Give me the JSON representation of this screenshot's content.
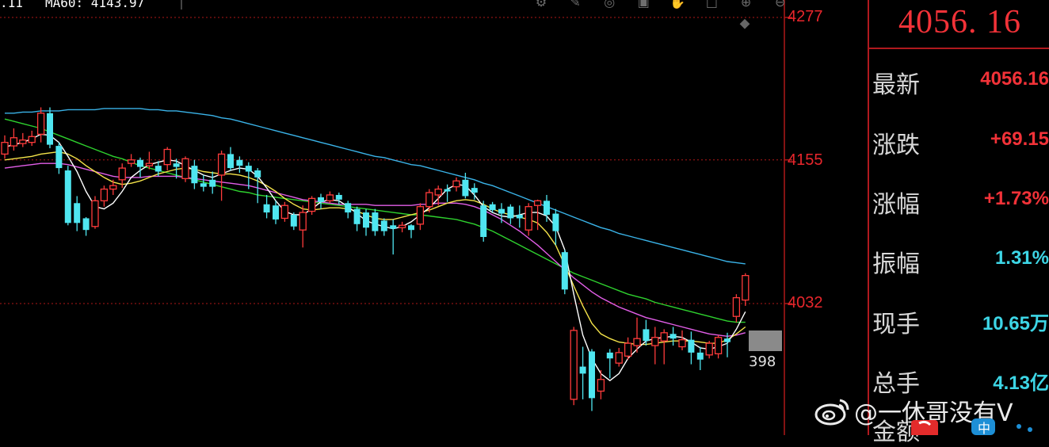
{
  "header": {
    "ma_fragment": ".11",
    "ma60_text": "MA60: 4143.97"
  },
  "toolbar": {
    "icons": [
      "gear-icon",
      "brush-icon",
      "target-icon",
      "image-icon",
      "hand-icon",
      "square-icon",
      "zoom-in-icon",
      "zoom-out-icon"
    ]
  },
  "axis": {
    "top_label": "4277",
    "mid_label": "4155",
    "low_label": "4032"
  },
  "volume_tag": "398",
  "quote": {
    "last_price": "4056. 16",
    "rows": [
      {
        "label": "最新",
        "value": "4056.16",
        "color": "#f23238"
      },
      {
        "label": "涨跌",
        "value": "+69.15",
        "color": "#f23238"
      },
      {
        "label": "涨幅",
        "value": "+1.73%",
        "color": "#f23238"
      },
      {
        "label": "振幅",
        "value": "1.31%",
        "color": "#3dd6e6"
      },
      {
        "label": "现手",
        "value": "10.65万",
        "color": "#3dd6e6"
      },
      {
        "label": "总手",
        "value": "4.13亿",
        "color": "#3dd6e6"
      },
      {
        "label": "金额",
        "value": "",
        "color": "#3dd6e6"
      }
    ]
  },
  "watermark": {
    "text": "@一休哥没有V"
  },
  "colors": {
    "up": "#ff3b3b",
    "down": "#4fe6f0",
    "ma5": "#ffffff",
    "ma10": "#f5e44a",
    "ma20": "#e25ee8",
    "ma30": "#2ed12e",
    "ma60": "#3ab3e8",
    "grid": "#b01818"
  },
  "chart_data": {
    "type": "candlestick",
    "y_ticks": [
      4277,
      4155,
      4032
    ],
    "candles": [
      {
        "o": 4160,
        "c": 4170,
        "h": 4176,
        "l": 4156,
        "up": true
      },
      {
        "o": 4167,
        "c": 4174,
        "h": 4182,
        "l": 4163,
        "up": true
      },
      {
        "o": 4169,
        "c": 4172,
        "h": 4178,
        "l": 4166,
        "up": true
      },
      {
        "o": 4170,
        "c": 4175,
        "h": 4180,
        "l": 4167,
        "up": true
      },
      {
        "o": 4177,
        "c": 4195,
        "h": 4200,
        "l": 4170,
        "up": true
      },
      {
        "o": 4195,
        "c": 4168,
        "h": 4200,
        "l": 4165,
        "up": false
      },
      {
        "o": 4167,
        "c": 4148,
        "h": 4170,
        "l": 4143,
        "up": false
      },
      {
        "o": 4146,
        "c": 4101,
        "h": 4150,
        "l": 4099,
        "up": false
      },
      {
        "o": 4118,
        "c": 4101,
        "h": 4124,
        "l": 4094,
        "up": false
      },
      {
        "o": 4105,
        "c": 4095,
        "h": 4106,
        "l": 4090,
        "up": false
      },
      {
        "o": 4098,
        "c": 4120,
        "h": 4124,
        "l": 4096,
        "up": true
      },
      {
        "o": 4120,
        "c": 4130,
        "h": 4133,
        "l": 4115,
        "up": true
      },
      {
        "o": 4130,
        "c": 4133,
        "h": 4138,
        "l": 4125,
        "up": true
      },
      {
        "o": 4138,
        "c": 4148,
        "h": 4152,
        "l": 4131,
        "up": true
      },
      {
        "o": 4152,
        "c": 4155,
        "h": 4160,
        "l": 4149,
        "up": true
      },
      {
        "o": 4155,
        "c": 4149,
        "h": 4157,
        "l": 4140,
        "up": false
      },
      {
        "o": 4150,
        "c": 4152,
        "h": 4162,
        "l": 4147,
        "up": true
      },
      {
        "o": 4150,
        "c": 4145,
        "h": 4154,
        "l": 4141,
        "up": false
      },
      {
        "o": 4151,
        "c": 4164,
        "h": 4166,
        "l": 4146,
        "up": true
      },
      {
        "o": 4152,
        "c": 4149,
        "h": 4156,
        "l": 4139,
        "up": false
      },
      {
        "o": 4139,
        "c": 4156,
        "h": 4158,
        "l": 4136,
        "up": true
      },
      {
        "o": 4150,
        "c": 4135,
        "h": 4155,
        "l": 4130,
        "up": false
      },
      {
        "o": 4135,
        "c": 4132,
        "h": 4142,
        "l": 4128,
        "up": false
      },
      {
        "o": 4138,
        "c": 4132,
        "h": 4145,
        "l": 4126,
        "up": false
      },
      {
        "o": 4142,
        "c": 4160,
        "h": 4163,
        "l": 4120,
        "up": true
      },
      {
        "o": 4160,
        "c": 4148,
        "h": 4166,
        "l": 4146,
        "up": false
      },
      {
        "o": 4155,
        "c": 4150,
        "h": 4158,
        "l": 4144,
        "up": false
      },
      {
        "o": 4150,
        "c": 4145,
        "h": 4153,
        "l": 4130,
        "up": false
      },
      {
        "o": 4146,
        "c": 4140,
        "h": 4148,
        "l": 4118,
        "up": false
      },
      {
        "o": 4117,
        "c": 4110,
        "h": 4125,
        "l": 4105,
        "up": false
      },
      {
        "o": 4116,
        "c": 4104,
        "h": 4120,
        "l": 4100,
        "up": false
      },
      {
        "o": 4105,
        "c": 4116,
        "h": 4119,
        "l": 4102,
        "up": true
      },
      {
        "o": 4108,
        "c": 4098,
        "h": 4110,
        "l": 4095,
        "up": false
      },
      {
        "o": 4095,
        "c": 4110,
        "h": 4116,
        "l": 4080,
        "up": true
      },
      {
        "o": 4111,
        "c": 4122,
        "h": 4124,
        "l": 4108,
        "up": true
      },
      {
        "o": 4123,
        "c": 4119,
        "h": 4126,
        "l": 4113,
        "up": false
      },
      {
        "o": 4120,
        "c": 4125,
        "h": 4128,
        "l": 4118,
        "up": true
      },
      {
        "o": 4125,
        "c": 4121,
        "h": 4127,
        "l": 4117,
        "up": false
      },
      {
        "o": 4118,
        "c": 4110,
        "h": 4120,
        "l": 4105,
        "up": false
      },
      {
        "o": 4113,
        "c": 4100,
        "h": 4115,
        "l": 4094,
        "up": false
      },
      {
        "o": 4110,
        "c": 4097,
        "h": 4113,
        "l": 4090,
        "up": false
      },
      {
        "o": 4110,
        "c": 4094,
        "h": 4113,
        "l": 4090,
        "up": false
      },
      {
        "o": 4103,
        "c": 4094,
        "h": 4105,
        "l": 4090,
        "up": false
      },
      {
        "o": 4099,
        "c": 4096,
        "h": 4104,
        "l": 4074,
        "up": false
      },
      {
        "o": 4097,
        "c": 4099,
        "h": 4102,
        "l": 4093,
        "up": true
      },
      {
        "o": 4099,
        "c": 4095,
        "h": 4100,
        "l": 4088,
        "up": false
      },
      {
        "o": 4100,
        "c": 4115,
        "h": 4118,
        "l": 4095,
        "up": true
      },
      {
        "o": 4115,
        "c": 4127,
        "h": 4130,
        "l": 4110,
        "up": true
      },
      {
        "o": 4125,
        "c": 4130,
        "h": 4133,
        "l": 4116,
        "up": true
      },
      {
        "o": 4130,
        "c": 4128,
        "h": 4134,
        "l": 4119,
        "up": false
      },
      {
        "o": 4132,
        "c": 4137,
        "h": 4140,
        "l": 4128,
        "up": true
      },
      {
        "o": 4138,
        "c": 4124,
        "h": 4144,
        "l": 4122,
        "up": false
      },
      {
        "o": 4131,
        "c": 4127,
        "h": 4135,
        "l": 4121,
        "up": false
      },
      {
        "o": 4116,
        "c": 4089,
        "h": 4120,
        "l": 4085,
        "up": false
      },
      {
        "o": 4117,
        "c": 4112,
        "h": 4119,
        "l": 4110,
        "up": false
      },
      {
        "o": 4113,
        "c": 4109,
        "h": 4118,
        "l": 4101,
        "up": false
      },
      {
        "o": 4115,
        "c": 4105,
        "h": 4117,
        "l": 4100,
        "up": false
      },
      {
        "o": 4108,
        "c": 4105,
        "h": 4116,
        "l": 4097,
        "up": false
      },
      {
        "o": 4095,
        "c": 4115,
        "h": 4118,
        "l": 4090,
        "up": true
      },
      {
        "o": 4116,
        "c": 4120,
        "h": 4121,
        "l": 4095,
        "up": true
      },
      {
        "o": 4120,
        "c": 4108,
        "h": 4125,
        "l": 4102,
        "up": false
      },
      {
        "o": 4109,
        "c": 4094,
        "h": 4113,
        "l": 4082,
        "up": false
      },
      {
        "o": 4076,
        "c": 4044,
        "h": 4078,
        "l": 4040,
        "up": false
      },
      {
        "o": 3950,
        "c": 4009,
        "h": 4012,
        "l": 3945,
        "up": true
      },
      {
        "o": 3978,
        "c": 3972,
        "h": 3995,
        "l": 3950,
        "up": false
      },
      {
        "o": 3991,
        "c": 3951,
        "h": 3993,
        "l": 3940,
        "up": false
      },
      {
        "o": 3957,
        "c": 3967,
        "h": 3975,
        "l": 3950,
        "up": true
      },
      {
        "o": 3990,
        "c": 3985,
        "h": 3993,
        "l": 3968,
        "up": false
      },
      {
        "o": 3981,
        "c": 3990,
        "h": 3994,
        "l": 3978,
        "up": true
      },
      {
        "o": 3987,
        "c": 3998,
        "h": 4003,
        "l": 3984,
        "up": true
      },
      {
        "o": 3996,
        "c": 4002,
        "h": 4020,
        "l": 3990,
        "up": true
      },
      {
        "o": 4010,
        "c": 4000,
        "h": 4018,
        "l": 3996,
        "up": false
      },
      {
        "o": 3996,
        "c": 4003,
        "h": 4012,
        "l": 3980,
        "up": true
      },
      {
        "o": 4000,
        "c": 4007,
        "h": 4010,
        "l": 3980,
        "up": true
      },
      {
        "o": 4006,
        "c": 4002,
        "h": 4012,
        "l": 3996,
        "up": false
      },
      {
        "o": 3995,
        "c": 4001,
        "h": 4009,
        "l": 3992,
        "up": true
      },
      {
        "o": 4001,
        "c": 3990,
        "h": 4008,
        "l": 3980,
        "up": false
      },
      {
        "o": 3990,
        "c": 3984,
        "h": 3995,
        "l": 3975,
        "up": false
      },
      {
        "o": 3988,
        "c": 3998,
        "h": 4000,
        "l": 3985,
        "up": true
      },
      {
        "o": 3989,
        "c": 4003,
        "h": 4005,
        "l": 3985,
        "up": true
      },
      {
        "o": 4002,
        "c": 3999,
        "h": 4007,
        "l": 3986,
        "up": false
      },
      {
        "o": 4021,
        "c": 4037,
        "h": 4040,
        "l": 4016,
        "up": true
      },
      {
        "o": 4035,
        "c": 4056,
        "h": 4058,
        "l": 4030,
        "up": true
      }
    ],
    "ma5": [
      4166,
      4168,
      4170,
      4173,
      4177,
      4176,
      4170,
      4158,
      4145,
      4128,
      4115,
      4113,
      4118,
      4128,
      4140,
      4146,
      4151,
      4153,
      4155,
      4154,
      4150,
      4146,
      4142,
      4140,
      4143,
      4146,
      4148,
      4147,
      4141,
      4131,
      4120,
      4111,
      4108,
      4108,
      4113,
      4119,
      4121,
      4120,
      4115,
      4109,
      4103,
      4100,
      4098,
      4096,
      4098,
      4102,
      4108,
      4114,
      4122,
      4130,
      4134,
      4133,
      4125,
      4115,
      4110,
      4107,
      4106,
      4108,
      4110,
      4110,
      4107,
      4098,
      4078,
      4040,
      4005,
      3985,
      3972,
      3966,
      3972,
      3985,
      3993,
      4000,
      4002,
      4003,
      4004,
      4003,
      3999,
      3994,
      3993,
      3995,
      3998,
      4010,
      4025
    ],
    "ma10": [
      4155,
      4156,
      4157,
      4158,
      4160,
      4161,
      4162,
      4160,
      4156,
      4150,
      4145,
      4140,
      4136,
      4134,
      4135,
      4137,
      4140,
      4143,
      4145,
      4147,
      4148,
      4147,
      4145,
      4144,
      4143,
      4143,
      4142,
      4140,
      4137,
      4133,
      4128,
      4122,
      4117,
      4113,
      4112,
      4113,
      4114,
      4114,
      4113,
      4111,
      4108,
      4105,
      4104,
      4104,
      4106,
      4108,
      4110,
      4112,
      4115,
      4118,
      4120,
      4121,
      4120,
      4117,
      4113,
      4110,
      4108,
      4106,
      4104,
      4101,
      4093,
      4082,
      4065,
      4047,
      4030,
      4015,
      4006,
      4002,
      3999,
      3998,
      3997,
      3997,
      3998,
      3999,
      4000,
      4000,
      4000,
      3999,
      3998,
      3998,
      4001,
      4006,
      4012
    ],
    "ma20": [
      4148,
      4149,
      4150,
      4151,
      4152,
      4152,
      4152,
      4151,
      4149,
      4147,
      4145,
      4143,
      4141,
      4140,
      4140,
      4140,
      4141,
      4141,
      4141,
      4141,
      4140,
      4139,
      4138,
      4137,
      4136,
      4135,
      4134,
      4133,
      4131,
      4129,
      4127,
      4125,
      4123,
      4121,
      4120,
      4119,
      4118,
      4117,
      4117,
      4117,
      4117,
      4116,
      4116,
      4116,
      4116,
      4116,
      4117,
      4117,
      4118,
      4118,
      4118,
      4117,
      4115,
      4112,
      4108,
      4104,
      4099,
      4094,
      4088,
      4082,
      4075,
      4068,
      4061,
      4054,
      4048,
      4042,
      4037,
      4033,
      4029,
      4026,
      4023,
      4020,
      4018,
      4016,
      4014,
      4012,
      4010,
      4008,
      4006,
      4005,
      4004,
      4005,
      4007
    ],
    "ma30": [
      4190,
      4188,
      4186,
      4184,
      4182,
      4179,
      4176,
      4173,
      4170,
      4167,
      4164,
      4161,
      4158,
      4156,
      4153,
      4150,
      4148,
      4146,
      4144,
      4142,
      4140,
      4138,
      4136,
      4134,
      4132,
      4130,
      4128,
      4127,
      4125,
      4124,
      4123,
      4122,
      4121,
      4120,
      4119,
      4118,
      4117,
      4116,
      4115,
      4114,
      4113,
      4112,
      4111,
      4110,
      4109,
      4108,
      4108,
      4107,
      4106,
      4105,
      4104,
      4102,
      4100,
      4097,
      4094,
      4090,
      4086,
      4082,
      4078,
      4074,
      4070,
      4066,
      4062,
      4058,
      4055,
      4052,
      4049,
      4046,
      4043,
      4040,
      4038,
      4036,
      4033,
      4031,
      4029,
      4027,
      4025,
      4023,
      4021,
      4019,
      4017,
      4016,
      4016
    ],
    "ma60": [
      4195,
      4195,
      4196,
      4196,
      4197,
      4197,
      4197,
      4198,
      4198,
      4198,
      4198,
      4199,
      4199,
      4199,
      4199,
      4199,
      4198,
      4198,
      4197,
      4197,
      4196,
      4195,
      4194,
      4193,
      4191,
      4190,
      4188,
      4186,
      4184,
      4182,
      4180,
      4178,
      4176,
      4174,
      4172,
      4170,
      4168,
      4166,
      4164,
      4162,
      4160,
      4158,
      4157,
      4155,
      4153,
      4151,
      4150,
      4148,
      4146,
      4144,
      4142,
      4140,
      4138,
      4135,
      4133,
      4130,
      4127,
      4124,
      4121,
      4118,
      4115,
      4112,
      4109,
      4106,
      4103,
      4100,
      4097,
      4095,
      4092,
      4090,
      4088,
      4086,
      4084,
      4082,
      4080,
      4078,
      4076,
      4074,
      4072,
      4070,
      4068,
      4067,
      4066
    ]
  }
}
